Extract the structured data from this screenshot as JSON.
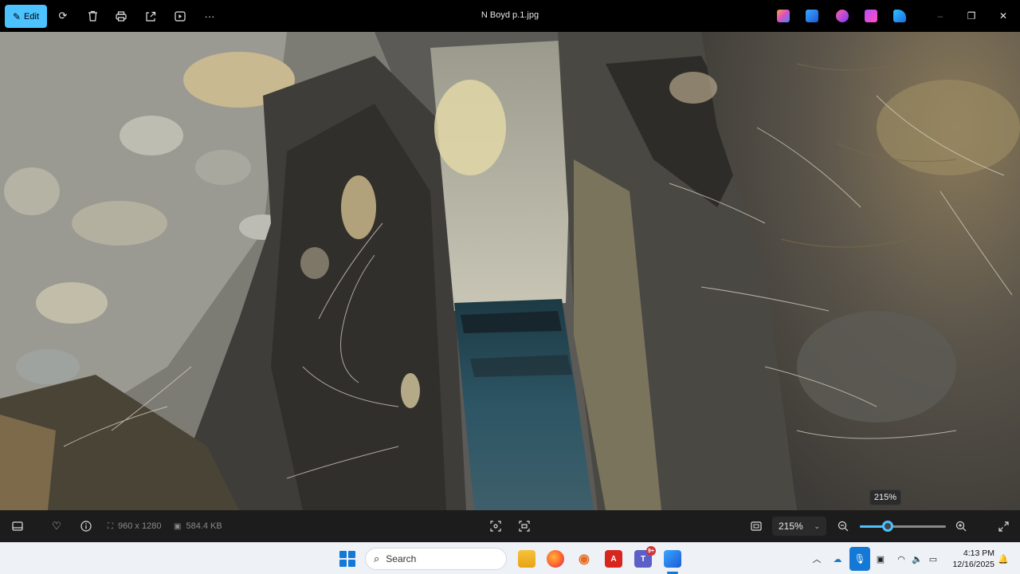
{
  "window": {
    "title": "N Boyd p.1.jpg",
    "edit_label": "Edit"
  },
  "toolbar": {
    "icons": [
      "edit-icon",
      "rotate-icon",
      "delete-icon",
      "print-icon",
      "share-icon",
      "slideshow-icon",
      "more-icon"
    ],
    "more_glyph": "···"
  },
  "title_bar_apps": [
    "copilot-icon",
    "photos-designer-icon",
    "clipchamp-icon",
    "paint-icon",
    "onedrive-edit-icon"
  ],
  "window_controls": {
    "minimize": "–",
    "maximize": "❐",
    "close": "✕"
  },
  "zoom_tooltip": "215%",
  "bottom_bar": {
    "dimensions": "960 x 1280",
    "file_size": "584.4 KB",
    "zoom_value": "215%",
    "zoom_level_fraction": 0.32
  },
  "taskbar": {
    "search_placeholder": "Search",
    "pinned_apps": [
      "file-explorer-icon",
      "firefox-icon",
      "podcast-icon",
      "acrobat-icon",
      "teams-icon",
      "photos-icon"
    ],
    "teams_badge": "9+",
    "clock_time": "4:13 PM",
    "clock_date": "12/16/2025"
  },
  "colors": {
    "accent": "#4cc2ff",
    "taskbar_blue": "#1479d6"
  }
}
